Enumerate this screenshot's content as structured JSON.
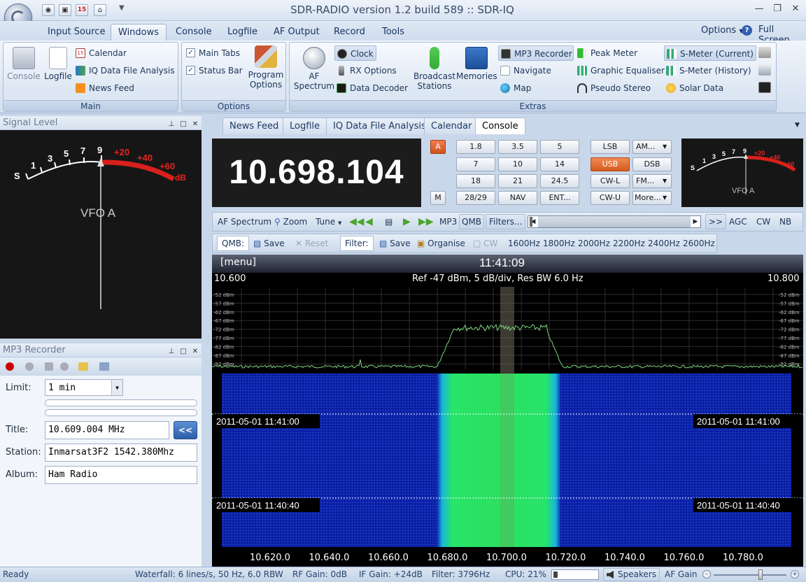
{
  "window": {
    "title": "SDR-RADIO version 1.2  build 589 :: SDR-IQ",
    "controls": [
      "minimize",
      "restore",
      "close"
    ]
  },
  "quick_access": [
    "camera-icon",
    "window-icon",
    "calendar-icon",
    "home-icon",
    "dropdown-icon"
  ],
  "quick_access_calendar_day": "15",
  "menu": {
    "tabs": [
      "Input Source",
      "Windows",
      "Console",
      "Logfile",
      "AF Output",
      "Record",
      "Tools"
    ],
    "active_tab": "Windows",
    "options_label": "Options",
    "help_icon": "?",
    "fullscreen_label": "Full Screen"
  },
  "ribbon": {
    "main": {
      "label": "Main",
      "console": "Console",
      "logfile": "Logfile",
      "calendar": "Calendar",
      "iq_analysis": "IQ Data File Analysis",
      "news_feed": "News Feed"
    },
    "options": {
      "label": "Options",
      "main_tabs": "Main Tabs",
      "status_bar": "Status Bar",
      "program_options_1": "Program",
      "program_options_2": "Options"
    },
    "extras": {
      "label": "Extras",
      "af_spectrum_1": "AF",
      "af_spectrum_2": "Spectrum",
      "clock": "Clock",
      "rx_options": "RX Options",
      "data_decoder": "Data Decoder",
      "broadcast_1": "Broadcast",
      "broadcast_2": "Stations",
      "memories": "Memories",
      "mp3_recorder": "MP3 Recorder",
      "navigate": "Navigate",
      "map": "Map",
      "peak_meter": "Peak Meter",
      "graphic_equaliser": "Graphic Equaliser",
      "pseudo_stereo": "Pseudo Stereo",
      "smeter_current": "S-Meter (Current)",
      "smeter_history": "S-Meter (History)",
      "solar_data": "Solar Data"
    }
  },
  "signal_level": {
    "title": "Signal Level",
    "scale_s": [
      "S",
      "1",
      "3",
      "5",
      "7",
      "9"
    ],
    "scale_db": [
      "+20",
      "+40",
      "+60",
      "dB"
    ],
    "vfo": "VFO A"
  },
  "mp3_recorder": {
    "title": "MP3 Recorder",
    "limit_label": "Limit:",
    "limit_value": "1 min",
    "title_label": "Title:",
    "title_value": "10.609.004 MHz",
    "station_label": "Station:",
    "station_value": "Inmarsat3F2 1542.380Mhz",
    "album_label": "Album:",
    "album_value": "Ham Radio",
    "back_button": "<<"
  },
  "doc_tabs": [
    "News Feed",
    "Logfile",
    "IQ Data File Analysis",
    "Calendar",
    "Console"
  ],
  "active_doc_tab": "Console",
  "console": {
    "frequency": "10.698.104",
    "vfo_a_button": "A",
    "m_button": "M",
    "band_buttons": [
      [
        "1.8",
        "3.5",
        "5"
      ],
      [
        "7",
        "10",
        "14"
      ],
      [
        "18",
        "21",
        "24.5"
      ],
      [
        "28/29",
        "NAV",
        "ENT..."
      ]
    ],
    "mode_buttons": [
      [
        "LSB",
        "AM..."
      ],
      [
        "USB",
        "DSB"
      ],
      [
        "CW-L",
        "FM..."
      ],
      [
        "CW-U",
        "More..."
      ]
    ],
    "active_mode": "USB",
    "meter_small": {
      "scale_s": [
        "S",
        "1",
        "3",
        "5",
        "7",
        "9"
      ],
      "scale_db": [
        "+20",
        "+40",
        "+60"
      ],
      "vfo": "VFO A"
    }
  },
  "toolbar1": {
    "af_spectrum": "AF Spectrum",
    "zoom": "Zoom",
    "tune": "Tune",
    "mp3": "MP3",
    "qmb": "QMB",
    "filters": "Filters...",
    "next": ">>",
    "agc": "AGC",
    "cw": "CW",
    "nb": "NB"
  },
  "toolbar2": {
    "qmb_label": "QMB:",
    "save": "Save",
    "reset": "Reset",
    "filter_label": "Filter:",
    "filter_save": "Save",
    "organise": "Organise",
    "cw": "CW",
    "filters": [
      "1600Hz",
      "1800Hz",
      "2000Hz",
      "2200Hz",
      "2400Hz",
      "2600Hz"
    ]
  },
  "spectrum": {
    "menu": "[menu]",
    "time": "11:41:09",
    "start": "10.600",
    "end": "10.800",
    "info": "Ref -47 dBm,  5 dB/div,  Res BW 6.0 Hz",
    "db_labels": [
      "-52 dBm",
      "-57 dBm",
      "-62 dBm",
      "-67 dBm",
      "-72 dBm",
      "-77 dBm",
      "-82 dBm",
      "-87 dBm",
      "-92 dBm"
    ],
    "waterfall_stamps": [
      "2011-05-01  11:41:00",
      "2011-05-01  11:40:40"
    ],
    "axis": [
      "10.620.0",
      "10.640.0",
      "10.660.0",
      "10.680.0",
      "10.700.0",
      "10.720.0",
      "10.740.0",
      "10.760.0",
      "10.780.0"
    ]
  },
  "status": {
    "ready": "Ready",
    "waterfall": "Waterfall: 6 lines/s, 50 Hz, 6.0 RBW",
    "rf_gain": "RF Gain: 0dB",
    "if_gain": "IF Gain: +24dB",
    "filter": "Filter: 3796Hz",
    "cpu": "CPU: 21%",
    "speakers": "Speakers",
    "af_gain": "AF Gain"
  },
  "colors": {
    "accent": "#d65a1e",
    "spectrum_trace": "#7dd67d",
    "waterfall_bg": "#0c1f9c",
    "waterfall_signal": "#27e46a",
    "meter_red": "#d8201c"
  }
}
